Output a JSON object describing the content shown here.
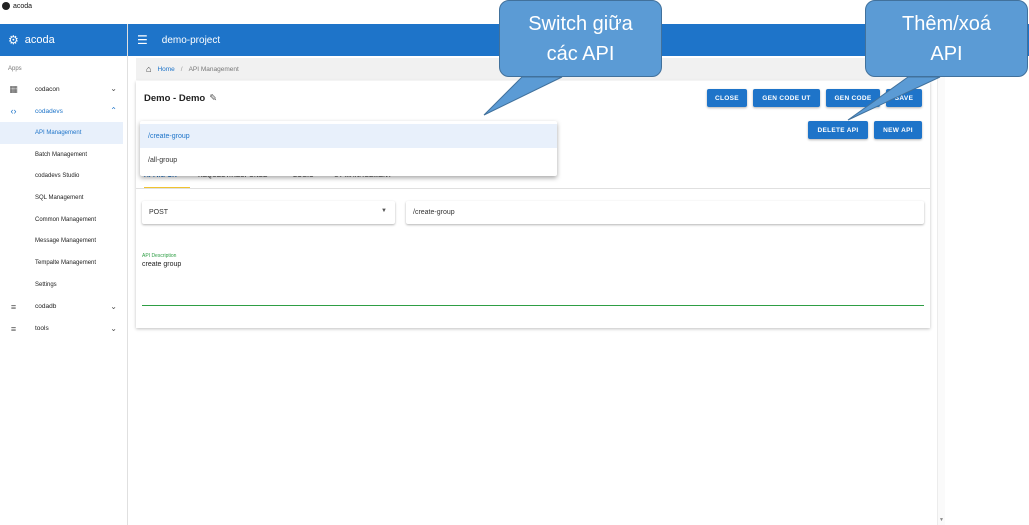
{
  "window": {
    "title": "acoda"
  },
  "sidebar": {
    "brand": "acoda",
    "section_label": "Apps",
    "groups": [
      {
        "label": "codacon",
        "icon": "grid-icon"
      },
      {
        "label": "codadevs",
        "icon": "code-icon"
      },
      {
        "label": "codadb",
        "icon": "database-icon"
      },
      {
        "label": "tools",
        "icon": "database-icon"
      }
    ],
    "items": [
      {
        "label": "API Management"
      },
      {
        "label": "Batch Management"
      },
      {
        "label": "codadevs Studio"
      },
      {
        "label": "SQL Management"
      },
      {
        "label": "Common Management"
      },
      {
        "label": "Message Management"
      },
      {
        "label": "Tempalte Management"
      },
      {
        "label": "Settings"
      }
    ]
  },
  "header": {
    "project": "demo-project"
  },
  "breadcrumb": {
    "home": "Home",
    "separator": "/",
    "current": "API Management"
  },
  "card": {
    "title": "Demo - Demo",
    "buttons": {
      "close": "CLOSE",
      "gen_code_ut": "GEN CODE UT",
      "gen_code": "GEN CODE",
      "save": "SAVE",
      "delete_api": "DELETE API",
      "new_api": "NEW API"
    },
    "tabs": [
      "API INFOR",
      "REQUEST/RESPONSE",
      "LOGIC",
      "UT MANAGEMENT"
    ],
    "method": "POST",
    "path": "/create-group",
    "description_label": "API Description",
    "description": "create group"
  },
  "dropdown": {
    "options": [
      "/create-group",
      "/all-group"
    ],
    "selected": "/create-group"
  },
  "callouts": {
    "switch_line1": "Switch giữa",
    "switch_line2": "các API",
    "add_line1": "Thêm/xoá",
    "add_line2": "API"
  },
  "colors": {
    "primary": "#1e74c9",
    "callout": "#5b9bd5",
    "accent_tab": "#f0c330",
    "green": "#2e9e44"
  }
}
